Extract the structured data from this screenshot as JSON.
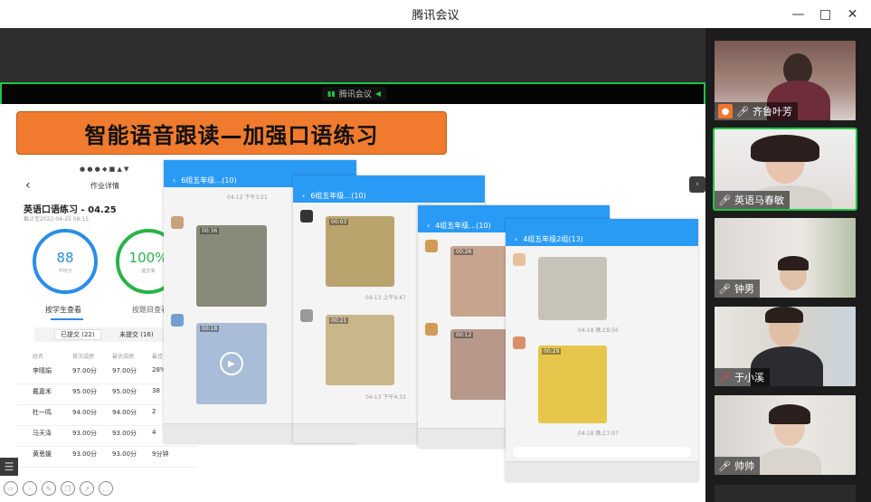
{
  "window": {
    "title": "腾讯会议"
  },
  "share": {
    "tag": "腾讯会议"
  },
  "slide": {
    "banner": "智能语音跟读—加强口语练习",
    "homework": {
      "nav_title": "作业详情",
      "title": "英语口语练习 - 04.25",
      "date": "截止至2022-04-25 08:15",
      "avg_score": "88",
      "avg_label": "平均分",
      "rate": "100%",
      "rate_label": "提交率",
      "tab_student": "按学生查看",
      "tab_question": "按题目查看",
      "chip_submitted": "已提交 (22)",
      "chip_unsubmitted": "未提交 (16)",
      "columns": [
        "姓名",
        "首次成绩",
        "最优成绩",
        "最佳"
      ],
      "rows": [
        [
          "李晴娟",
          "97.00分",
          "97.00分",
          "28%"
        ],
        [
          "戴嘉禾",
          "95.00分",
          "95.00分",
          "38"
        ],
        [
          "杜一鸣",
          "94.00分",
          "94.00分",
          "2"
        ],
        [
          "马天泽",
          "93.00分",
          "93.00分",
          "4"
        ],
        [
          "黄思媛",
          "93.00分",
          "93.00分",
          "9分钟"
        ]
      ]
    },
    "chats": [
      {
        "header": "6组五年级…(10)",
        "time1": "04-12 下午3:21",
        "time2": "04-13 下午4:33",
        "dur1": "00:36",
        "dur2": "00:18"
      },
      {
        "header": "6组五年级…(10)",
        "time1": "04-13 上午9:47",
        "time2": "04-13 下午4:33",
        "dur1": "00:03",
        "dur2": "00:21"
      },
      {
        "header": "4组五年级…(10)",
        "dur1": "00:26",
        "dur2": "00:12"
      },
      {
        "header": "4组五年级2组(13)",
        "time1": "04-18 晚上8:56",
        "time2": "04-18 晚上7:07",
        "dur1": "00:29"
      }
    ]
  },
  "participants": [
    {
      "name": "齐鲁叶芳",
      "host": true,
      "muted": false,
      "speaking": false
    },
    {
      "name": "英语马春敏",
      "host": false,
      "muted": false,
      "speaking": true
    },
    {
      "name": "钟男",
      "host": false,
      "muted": false,
      "speaking": false
    },
    {
      "name": "于小溪",
      "host": false,
      "muted": true,
      "speaking": false
    },
    {
      "name": "帅帅",
      "host": false,
      "muted": false,
      "speaking": false
    }
  ],
  "colors": {
    "accent_green": "#1ec447",
    "banner": "#f07b2e",
    "chat_blue": "#2a9bf5",
    "host_orange": "#f2762e"
  }
}
